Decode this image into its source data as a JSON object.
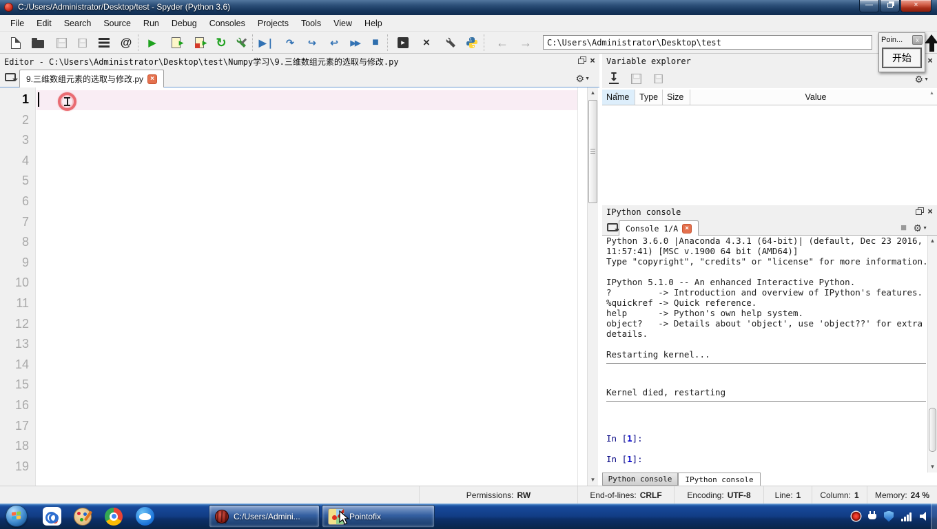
{
  "window": {
    "title": "C:/Users/Administrator/Desktop/test - Spyder (Python 3.6)",
    "controls": {
      "minimize": "—",
      "close": "×"
    }
  },
  "menu": {
    "items": [
      "File",
      "Edit",
      "Search",
      "Source",
      "Run",
      "Debug",
      "Consoles",
      "Projects",
      "Tools",
      "View",
      "Help"
    ]
  },
  "toolbar": {
    "address": "C:\\Users\\Administrator\\Desktop\\test",
    "glyphs": {
      "at": "@",
      "run": "▶",
      "rerun": "↻",
      "debug_play": "▶❘",
      "step_over": "↷",
      "step_into": "↪",
      "step_out": "↩",
      "continue2": "▶▶",
      "stop": "■",
      "back": "←",
      "forward": "→",
      "maximize": "×",
      "export_arrow": "▸",
      "gear": "⚙",
      "gear_caret": "▼",
      "import": "↧",
      "scroll_up": "▲",
      "scroll_down": "▼",
      "sort_caret": "▲"
    }
  },
  "pointofix": {
    "title": "Poin...",
    "close": "x",
    "start_button": "开始"
  },
  "editor": {
    "pane_title": "Editor - C:\\Users\\Administrator\\Desktop\\test\\Numpy学习\\9.三维数组元素的选取与修改.py",
    "tab_label": "9.三维数组元素的选取与修改.py",
    "tab_close": "×",
    "line_numbers": [
      "1",
      "2",
      "3",
      "4",
      "5",
      "6",
      "7",
      "8",
      "9",
      "10",
      "11",
      "12",
      "13",
      "14",
      "15",
      "16",
      "17",
      "18",
      "19"
    ],
    "active_line": "1"
  },
  "variable_explorer": {
    "pane_title": "Variable explorer",
    "columns": {
      "name": "Name",
      "type": "Type",
      "size": "Size",
      "value": "Value"
    }
  },
  "ipython_console": {
    "pane_title": "IPython console",
    "tab_label": "Console 1/A",
    "tab_close": "×",
    "stop_glyph": "■",
    "banner": [
      "Python 3.6.0 |Anaconda 4.3.1 (64-bit)| (default, Dec 23 2016,",
      "11:57:41) [MSC v.1900 64 bit (AMD64)]",
      "Type \"copyright\", \"credits\" or \"license\" for more information.",
      "",
      "IPython 5.1.0 -- An enhanced Interactive Python.",
      "?         -> Introduction and overview of IPython's features.",
      "%quickref -> Quick reference.",
      "help      -> Python's own help system.",
      "object?   -> Details about 'object', use 'object??' for extra",
      "details."
    ],
    "restarting": "Restarting kernel...",
    "kernel_died": "Kernel died, restarting",
    "prompt": {
      "pre": "In [",
      "num": "1",
      "post": "]:"
    },
    "bottom_tabs": [
      "Python console",
      "IPython console"
    ]
  },
  "statusbar": {
    "segments": [
      {
        "label": "Permissions:",
        "value": "RW"
      },
      {
        "label": "End-of-lines:",
        "value": "CRLF"
      },
      {
        "label": "Encoding:",
        "value": "UTF-8"
      },
      {
        "label": "Line:",
        "value": "1"
      },
      {
        "label": "Column:",
        "value": "1"
      },
      {
        "label": "Memory:",
        "value": "24 %"
      }
    ]
  },
  "taskbar": {
    "buttons": [
      {
        "label": "C:/Users/Admini..."
      },
      {
        "label": "Pointofix"
      }
    ]
  }
}
